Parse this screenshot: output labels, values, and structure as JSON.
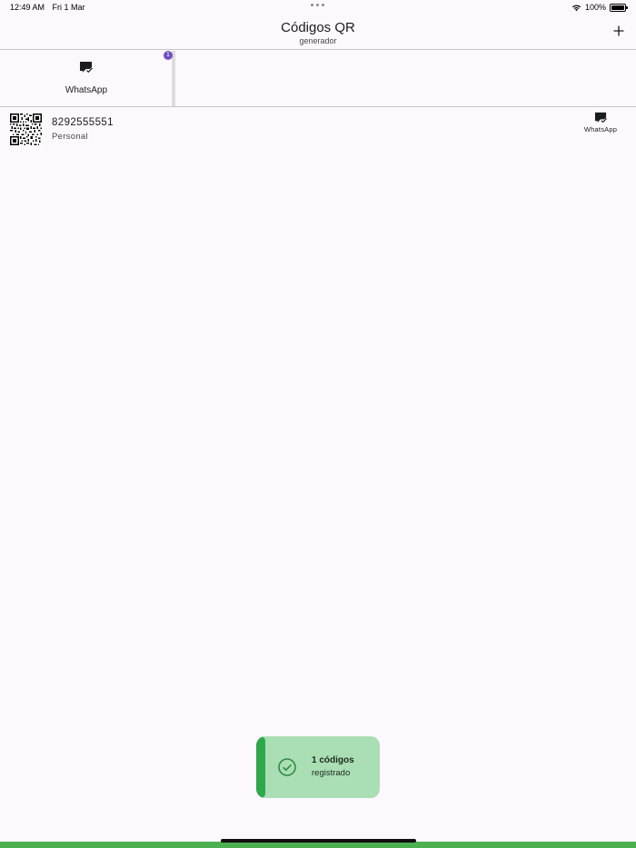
{
  "status_bar": {
    "time": "12:49 AM",
    "date": "Fri 1 Mar",
    "battery": "100%"
  },
  "header": {
    "title": "Códigos QR",
    "subtitle": "generador",
    "add_icon": "plus-icon"
  },
  "categories": [
    {
      "label": "WhatsApp",
      "icon": "whatsapp-message-icon",
      "badge": "1"
    }
  ],
  "codes": [
    {
      "number": "8292555551",
      "label": "Personal",
      "type": "WhatsApp",
      "icon": "whatsapp-message-icon"
    }
  ],
  "toast": {
    "title": "1 códigos",
    "body": "registrado",
    "icon": "check-circle-icon",
    "accent_color": "#2ea84a",
    "background_color": "#aadeb4"
  },
  "colors": {
    "badge": "#6f4fc2",
    "bottom_bar": "#4caf50",
    "background": "#fdf8fd"
  }
}
